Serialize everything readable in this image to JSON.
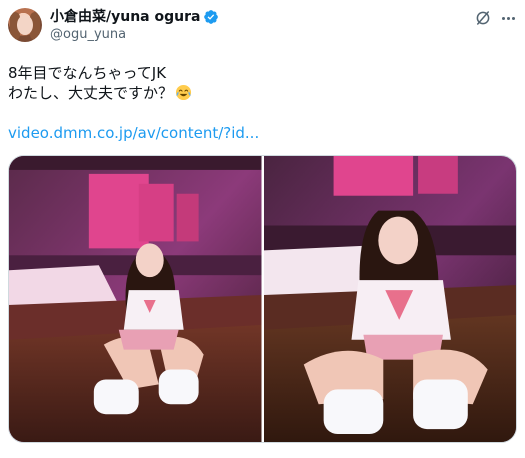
{
  "tweet": {
    "author": {
      "display_name": "小倉由菜/yuna ogura",
      "handle": "@ogu_yuna",
      "verified": true,
      "verified_color": "#1d9bf0"
    },
    "text_lines": [
      "8年目でなんちゃってJK",
      "わたし、大丈夫ですか？"
    ],
    "text_emoji": "face-with-tears-of-joy",
    "link_text": "video.dmm.co.jp/av/content/?id...",
    "link_color": "#1d9bf0",
    "header_icons": [
      "grok-icon",
      "more-icon"
    ],
    "media": [
      {
        "name": "photo-1",
        "alt": ""
      },
      {
        "name": "photo-2",
        "alt": ""
      }
    ]
  }
}
